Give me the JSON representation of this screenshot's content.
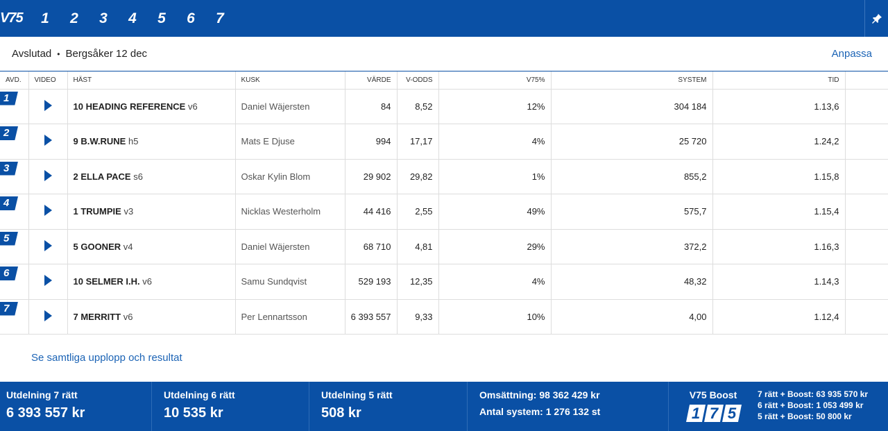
{
  "topbar": {
    "brand": "V75",
    "races": [
      "1",
      "2",
      "3",
      "4",
      "5",
      "6",
      "7"
    ]
  },
  "subheader": {
    "status": "Avslutad",
    "track": "Bergsåker 12 dec",
    "customize": "Anpassa"
  },
  "table": {
    "headers": {
      "avd": "AVD.",
      "video": "VIDEO",
      "hast": "HÄST",
      "kusk": "KUSK",
      "varde": "VÄRDE",
      "vodds": "V-ODDS",
      "v75": "V75%",
      "system": "SYSTEM",
      "tid": "TID"
    },
    "rows": [
      {
        "avd": "1",
        "horse": "10 HEADING REFERENCE",
        "meta": "v6",
        "kusk": "Daniel Wäjersten",
        "varde": "84",
        "vodds": "8,52",
        "v75": "12%",
        "system": "304 184",
        "tid": "1.13,6"
      },
      {
        "avd": "2",
        "horse": "9 B.W.RUNE",
        "meta": "h5",
        "kusk": "Mats E Djuse",
        "varde": "994",
        "vodds": "17,17",
        "v75": "4%",
        "system": "25 720",
        "tid": "1.24,2"
      },
      {
        "avd": "3",
        "horse": "2 ELLA PACE",
        "meta": "s6",
        "kusk": "Oskar Kylin Blom",
        "varde": "29 902",
        "vodds": "29,82",
        "v75": "1%",
        "system": "855,2",
        "tid": "1.15,8"
      },
      {
        "avd": "4",
        "horse": "1 TRUMPIE",
        "meta": "v3",
        "kusk": "Nicklas Westerholm",
        "varde": "44 416",
        "vodds": "2,55",
        "v75": "49%",
        "system": "575,7",
        "tid": "1.15,4"
      },
      {
        "avd": "5",
        "horse": "5 GOONER",
        "meta": "v4",
        "kusk": "Daniel Wäjersten",
        "varde": "68 710",
        "vodds": "4,81",
        "v75": "29%",
        "system": "372,2",
        "tid": "1.16,3"
      },
      {
        "avd": "6",
        "horse": "10 SELMER I.H.",
        "meta": "v6",
        "kusk": "Samu Sundqvist",
        "varde": "529 193",
        "vodds": "12,35",
        "v75": "4%",
        "system": "48,32",
        "tid": "1.14,3"
      },
      {
        "avd": "7",
        "horse": "7 MERRITT",
        "meta": "v6",
        "kusk": "Per Lennartsson",
        "varde": "6 393 557",
        "vodds": "9,33",
        "v75": "10%",
        "system": "4,00",
        "tid": "1.12,4"
      }
    ]
  },
  "link_all": "Se samtliga upplopp och resultat",
  "footer": {
    "payouts": [
      {
        "label": "Utdelning 7 rätt",
        "value": "6 393 557 kr"
      },
      {
        "label": "Utdelning 6 rätt",
        "value": "10 535 kr"
      },
      {
        "label": "Utdelning 5 rätt",
        "value": "508 kr"
      }
    ],
    "turnover": "Omsättning: 98 362 429 kr",
    "systems": "Antal system: 1 276 132 st",
    "boost_label": "V75 Boost",
    "boost_digits": [
      "1",
      "7",
      "5"
    ],
    "boost_rows": [
      "7 rätt + Boost: 63 935 570 kr",
      "6 rätt + Boost: 1 053 499 kr",
      "5 rätt + Boost: 50 800 kr"
    ]
  },
  "colors": {
    "brand_blue": "#0a50a5",
    "link_blue": "#1b63b5"
  }
}
